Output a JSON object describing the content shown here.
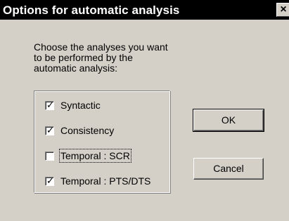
{
  "window": {
    "title": "Options for automatic analysis",
    "close_label": "×"
  },
  "instructions": "Choose the analyses you want\nto be performed by the\nautomatic analysis:",
  "checkboxes": [
    {
      "label": "Syntactic",
      "checked": true,
      "focused": false
    },
    {
      "label": "Consistency",
      "checked": true,
      "focused": false
    },
    {
      "label": "Temporal : SCR",
      "checked": false,
      "focused": true
    },
    {
      "label": "Temporal : PTS/DTS",
      "checked": true,
      "focused": false
    }
  ],
  "buttons": {
    "ok_label": "OK",
    "cancel_label": "Cancel"
  },
  "check_glyph": "✓"
}
